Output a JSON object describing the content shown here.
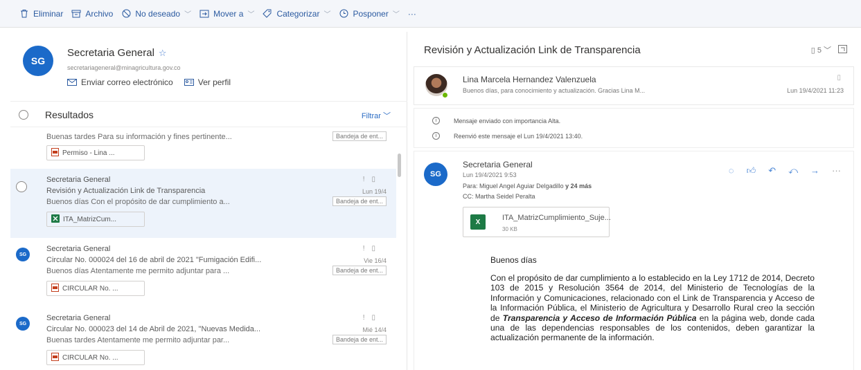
{
  "toolbar": {
    "items": [
      {
        "label": "Eliminar",
        "icon": "trash-icon",
        "chevron": false
      },
      {
        "label": "Archivo",
        "icon": "archive-icon",
        "chevron": false
      },
      {
        "label": "No deseado",
        "icon": "block-icon",
        "chevron": true
      },
      {
        "label": "Mover a",
        "icon": "move-icon",
        "chevron": true
      },
      {
        "label": "Categorizar",
        "icon": "tag-icon",
        "chevron": true
      },
      {
        "label": "Posponer",
        "icon": "clock-icon",
        "chevron": true
      }
    ],
    "more": "···"
  },
  "contact": {
    "initials": "SG",
    "name": "Secretaria General",
    "email": "secretariageneral@minagricultura.gov.co",
    "send_email": "Enviar correo electrónico",
    "view_profile": "Ver perfil"
  },
  "results": {
    "title": "Resultados",
    "filter": "Filtrar"
  },
  "messages": [
    {
      "preview": "Buenas tardes Para su información y fines pertinente...",
      "folder": "Bandeja de ent...",
      "attachment": "Permiso - Lina ..."
    },
    {
      "sender": "Secretaria General",
      "subject": "Revisión y Actualización Link de Transparencia",
      "date": "Lun 19/4",
      "preview": "Buenos días Con el propósito de dar cumplimiento a...",
      "folder": "Bandeja de ent...",
      "attachment": "ITA_MatrizCum..."
    },
    {
      "initials": "SG",
      "sender": "Secretaria General",
      "subject": "Circular No. 000024 del 16 de abril de 2021 \"Fumigación Edifi...",
      "date": "Vie 16/4",
      "preview": "Buenos días Atentamente me permito adjuntar para ...",
      "folder": "Bandeja de ent...",
      "attachment": "CIRCULAR No. ..."
    },
    {
      "initials": "SG",
      "sender": "Secretaria General",
      "subject": "Circular No. 000023 del 14 de Abril de 2021, \"Nuevas Medida...",
      "date": "Mié 14/4",
      "preview": "Buenas tardes Atentamente me permito adjuntar par...",
      "folder": "Bandeja de ent...",
      "attachment": "CIRCULAR No. ..."
    }
  ],
  "reading": {
    "title": "Revisión y Actualización Link de Transparencia",
    "count": "5",
    "collapsed": {
      "name": "Lina Marcela Hernandez Valenzuela",
      "preview": "Buenos días, para conocimiento y actualización. Gracias Lina M...",
      "date": "Lun 19/4/2021 11:23"
    },
    "notice_importance": "Mensaje enviado con importancia Alta.",
    "notice_forward": "Reenvió este mensaje el Lun 19/4/2021 13:40.",
    "open": {
      "initials": "SG",
      "sender": "Secretaria General",
      "date": "Lun 19/4/2021 9:53",
      "to_label": "Para:",
      "to": "Miguel Angel Aguiar Delgadillo",
      "to_more": "y 24 más",
      "cc_label": "CC:",
      "cc": "Martha Seidel Peralta",
      "attachment_name": "ITA_MatrizCumplimiento_Suje...",
      "attachment_size": "30 KB",
      "greeting": "Buenos días",
      "body_1": "Con el propósito de dar cumplimiento a lo establecido en la Ley 1712 de 2014, Decreto 103 de 2015 y Resolución 3564 de 2014, del Ministerio de Tecnologías de la Información y Comunicaciones, relacionado con el Link de Transparencia y Acceso de la Información Pública, el Ministerio de Agricultura y Desarrollo Rural creo la sección de ",
      "body_bold": "Transparencia y Acceso de Información Pública",
      "body_2": " en la página web, donde cada una de las dependencias responsables de los contenidos, deben garantizar la actualización permanente de la información."
    }
  }
}
